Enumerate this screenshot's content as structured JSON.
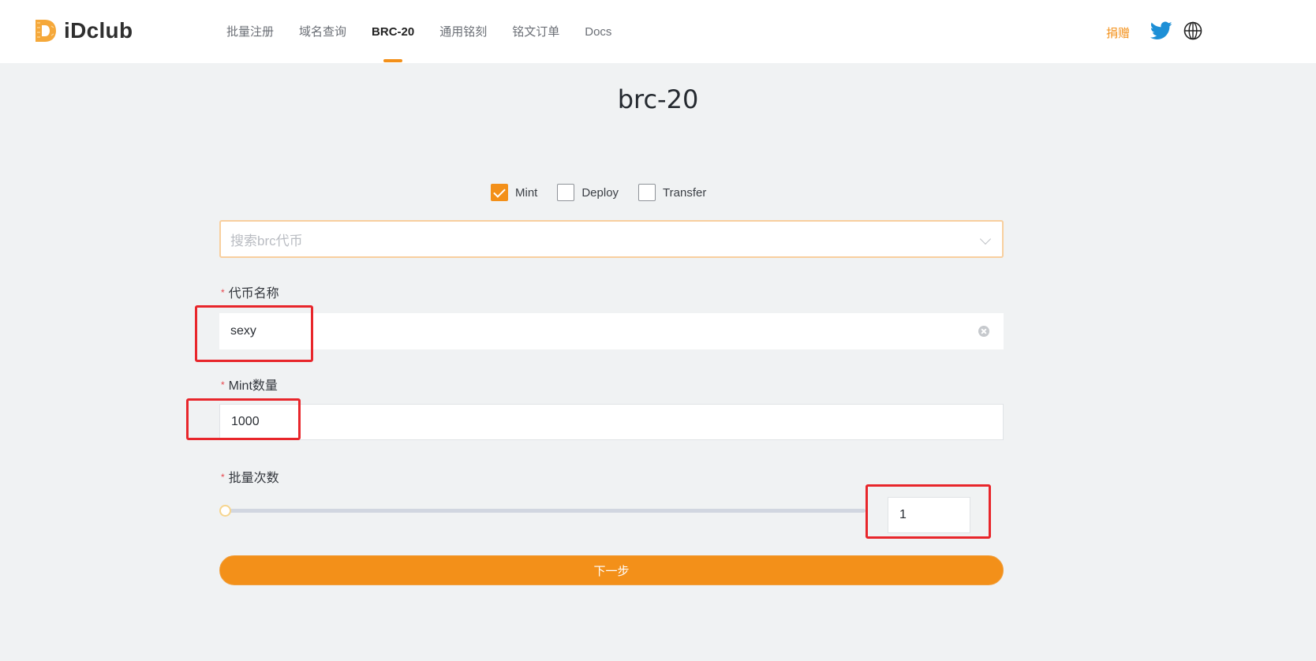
{
  "header": {
    "brand": "iDclub",
    "nav": [
      {
        "label": "批量注册",
        "active": false
      },
      {
        "label": "域名查询",
        "active": false
      },
      {
        "label": "BRC-20",
        "active": true
      },
      {
        "label": "通用铭刻",
        "active": false
      },
      {
        "label": "铭文订单",
        "active": false
      },
      {
        "label": "Docs",
        "active": false
      }
    ],
    "donate_label": "捐赠",
    "icons": {
      "twitter": "twitter-icon",
      "language": "globe-icon"
    },
    "accent_color": "#f39019"
  },
  "page": {
    "title": "brc-20"
  },
  "operation": {
    "options": [
      {
        "label": "Mint",
        "checked": true
      },
      {
        "label": "Deploy",
        "checked": false
      },
      {
        "label": "Transfer",
        "checked": false
      }
    ]
  },
  "token_search": {
    "placeholder": "搜索brc代币",
    "value": ""
  },
  "form": {
    "token_name": {
      "label": "代币名称",
      "required_mark": "*",
      "value": "sexy"
    },
    "mint_amount": {
      "label": "Mint数量",
      "required_mark": "*",
      "value": "1000"
    },
    "batch_count": {
      "label": "批量次数",
      "required_mark": "*",
      "value": "1",
      "slider_fraction": 0
    }
  },
  "actions": {
    "next_label": "下一步"
  },
  "annotations": {
    "highlight_color": "#e8262b",
    "highlighted_fields": [
      "token_name",
      "mint_amount",
      "batch_count"
    ]
  }
}
